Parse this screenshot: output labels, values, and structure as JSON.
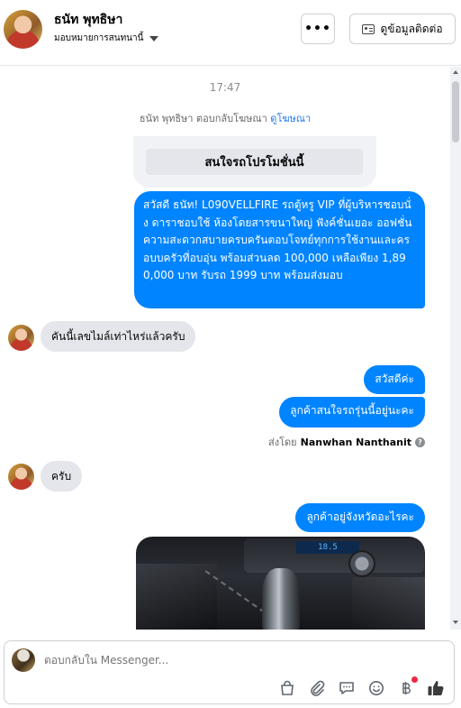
{
  "header": {
    "contact_name": "ธนัท พุทธิษา",
    "assign_label": "มอบหมายการสนทนานี้",
    "more_label": "•••",
    "view_contact_label": "ดูข้อมูลติดต่อ"
  },
  "conversation": {
    "timestamp": "17:47",
    "reply_note": "ธนัท พุทธิษา ตอบกลับโฆษณา",
    "reply_note_link": "ดูโฆษณา",
    "ad_button": "สนใจรถโปรโมชั่นนี้",
    "messages": [
      {
        "direction": "out",
        "text": "สวัสดี ธนัท! L090VELLFIRE รถตู้หรู VIP ที่ผู้บริหารชอบนั่ง ดาราชอบใช้ ห้องโดยสารขนาใหญ่ ฟังค์ชั่นเยอะ ออฟชั่นความสะดวกสบายครบครันตอบโจทย์ทุกการใช้งานและครอบบครัวที่อบอุ่น พร้อมส่วนลด 100,000 เหลือเพียง 1,890,000 บาท รับรถ 1999 บาท พร้อมส่งมอบ"
      },
      {
        "direction": "in",
        "text": "คันนี้เลขไมล์เท่าไหร่แล้วครับ"
      },
      {
        "direction": "out",
        "text": "สวัสดีค่ะ"
      },
      {
        "direction": "out",
        "text": "ลูกค้าสนใจรถรุ่นนี้อยู่นะคะ"
      },
      {
        "direction": "in",
        "text": "ครับ"
      },
      {
        "direction": "out",
        "text": "ลูกค้าอยู่จังหวัดอะไรคะ"
      }
    ],
    "sent_by_prefix": "ส่งโดย",
    "sent_by_name": "Nanwhan Nanthanit",
    "photo_screen_text": "18.5"
  },
  "composer": {
    "placeholder": "ตอบกลับใน Messenger...",
    "icons": [
      "shopping-bag-icon",
      "attachment-icon",
      "saved-reply-icon",
      "emoji-icon",
      "baht-icon",
      "thumbs-up-icon"
    ]
  },
  "colors": {
    "accent": "#0084ff",
    "incoming_bubble": "#e4e6eb",
    "notification_dot": "#f02849"
  }
}
